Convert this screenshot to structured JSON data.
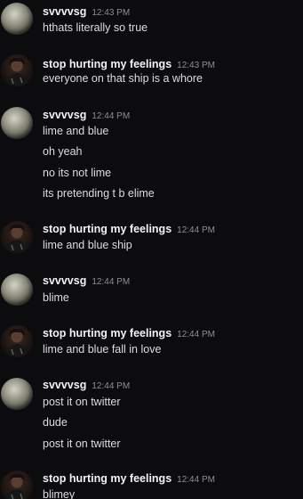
{
  "colors": {
    "background": "#0c0c0f",
    "username": "#f2f3f5",
    "timestamp": "#8a8e96",
    "message_text": "#dcdde1"
  },
  "messages": [
    {
      "user": "svvvvsg",
      "time": "12:43 PM",
      "avatar": "grey-orb-avatar",
      "lines": [
        "hthats literally so true"
      ]
    },
    {
      "user": "stop hurting my feelings",
      "time": "12:43 PM",
      "avatar": "profile-photo-avatar",
      "lines": [
        "everyone on that ship is a whore"
      ]
    },
    {
      "user": "svvvvsg",
      "time": "12:44 PM",
      "avatar": "grey-orb-avatar",
      "lines": [
        "lime and blue",
        "oh yeah",
        "no its not lime",
        "its pretending t b elime"
      ]
    },
    {
      "user": "stop hurting my feelings",
      "time": "12:44 PM",
      "avatar": "profile-photo-avatar",
      "lines": [
        "lime and blue ship"
      ]
    },
    {
      "user": "svvvvsg",
      "time": "12:44 PM",
      "avatar": "grey-orb-avatar",
      "lines": [
        "blime"
      ]
    },
    {
      "user": "stop hurting my feelings",
      "time": "12:44 PM",
      "avatar": "profile-photo-avatar",
      "lines": [
        "lime and blue fall in love"
      ]
    },
    {
      "user": "svvvvsg",
      "time": "12:44 PM",
      "avatar": "grey-orb-avatar",
      "lines": [
        "post it on twitter",
        "dude",
        "post it on twitter"
      ]
    },
    {
      "user": "stop hurting my feelings",
      "time": "12:44 PM",
      "avatar": "profile-photo-avatar",
      "lines": [
        "blimey"
      ]
    }
  ]
}
